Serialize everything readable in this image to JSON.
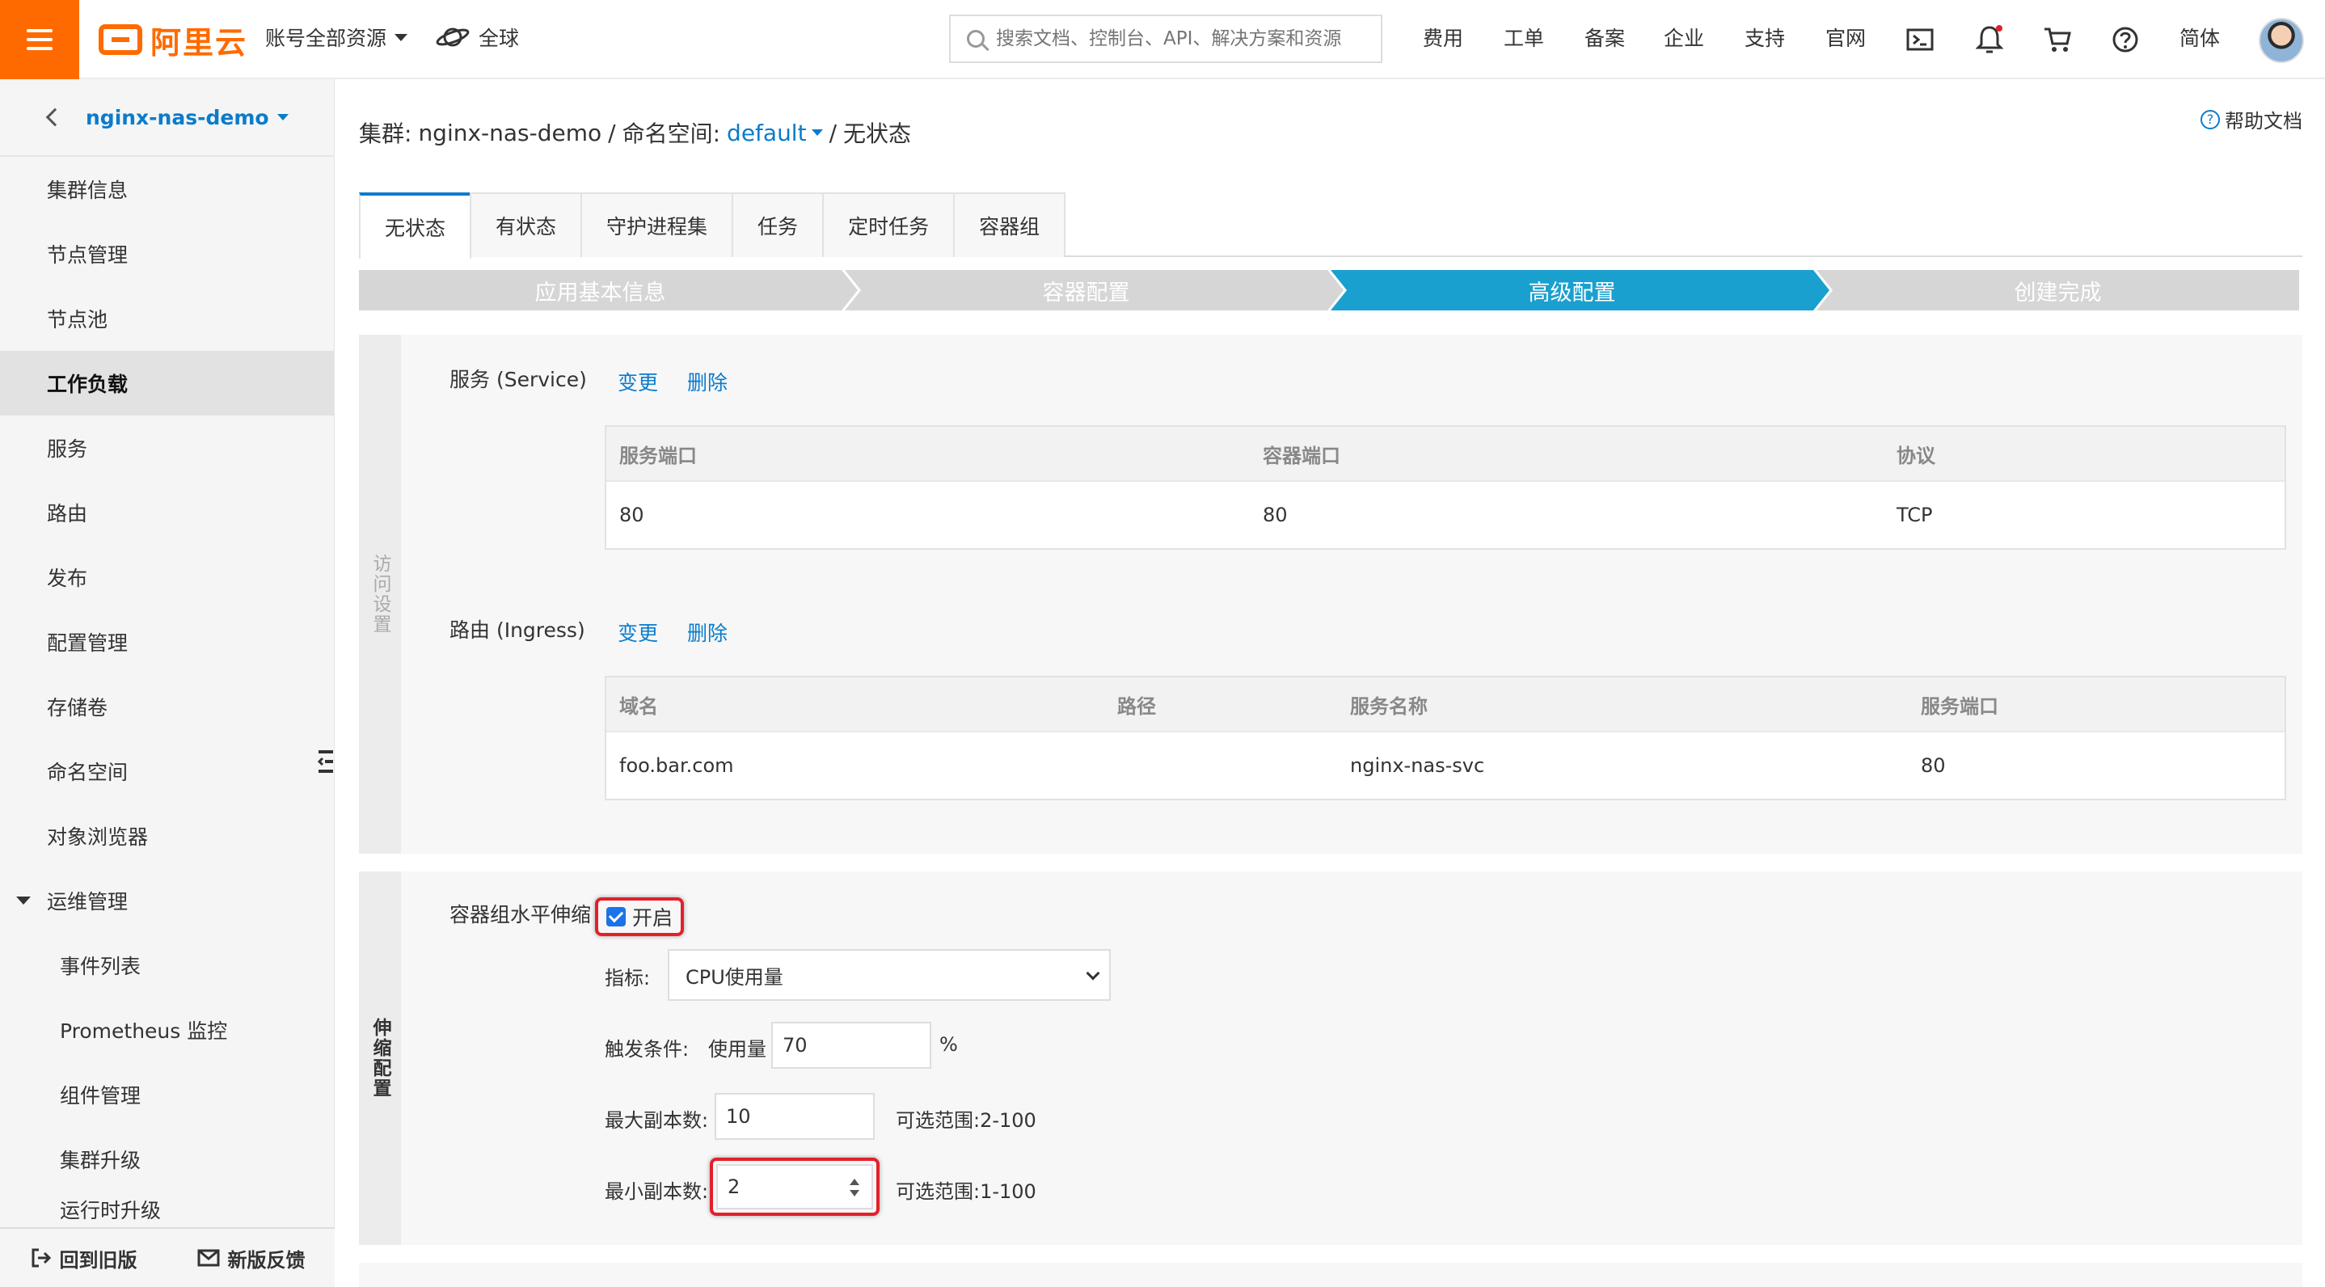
{
  "topbar": {
    "logo_text": "阿里云",
    "account_resources": "账号全部资源",
    "region": "全球",
    "search_placeholder": "搜索文档、控制台、API、解决方案和资源",
    "nav": [
      "费用",
      "工单",
      "备案",
      "企业",
      "支持",
      "官网"
    ],
    "lang": "简体"
  },
  "sidebar": {
    "cluster": "nginx-nas-demo",
    "items": [
      "集群信息",
      "节点管理",
      "节点池",
      "工作负载",
      "服务",
      "路由",
      "发布",
      "配置管理",
      "存储卷",
      "命名空间",
      "对象浏览器"
    ],
    "active_item": "工作负载",
    "group": "运维管理",
    "sub_items": [
      "事件列表",
      "Prometheus 监控",
      "组件管理",
      "集群升级",
      "运行时升级"
    ],
    "bottom": {
      "old_version": "回到旧版",
      "feedback": "新版反馈"
    }
  },
  "breadcrumb": {
    "cluster_label": "集群:",
    "cluster_name": "nginx-nas-demo",
    "sep1": "/",
    "ns_label": "命名空间:",
    "ns_value": "default",
    "sep2": "/",
    "current": "无状态"
  },
  "help": "帮助文档",
  "tabs": [
    "无状态",
    "有状态",
    "守护进程集",
    "任务",
    "定时任务",
    "容器组"
  ],
  "steps": [
    "应用基本信息",
    "容器配置",
    "高级配置",
    "创建完成"
  ],
  "access": {
    "label": "访问设置",
    "service": {
      "title": "服务 (Service)",
      "change": "变更",
      "delete": "删除",
      "headers": [
        "服务端口",
        "容器端口",
        "协议"
      ],
      "row": [
        "80",
        "80",
        "TCP"
      ]
    },
    "ingress": {
      "title": "路由 (Ingress)",
      "change": "变更",
      "delete": "删除",
      "headers": [
        "域名",
        "路径",
        "服务名称",
        "服务端口"
      ],
      "row": [
        "foo.bar.com",
        "",
        "nginx-nas-svc",
        "80"
      ]
    }
  },
  "scaling": {
    "label": "伸缩配置",
    "hpa_title": "容器组水平伸缩",
    "enable_label": "开启",
    "enabled": true,
    "metric_label": "指标:",
    "metric_value": "CPU使用量",
    "trigger_label": "触发条件:",
    "usage_label": "使用量",
    "usage_value": "70",
    "usage_unit": "%",
    "max_label": "最大副本数:",
    "max_value": "10",
    "max_range": "可选范围:2-100",
    "min_label": "最小副本数:",
    "min_value": "2",
    "min_range": "可选范围:1-100"
  },
  "colors": {
    "accent": "#0a7bcc",
    "brand": "#ff6a00",
    "step_active": "#1aa0cf",
    "highlight": "#e3202a"
  }
}
